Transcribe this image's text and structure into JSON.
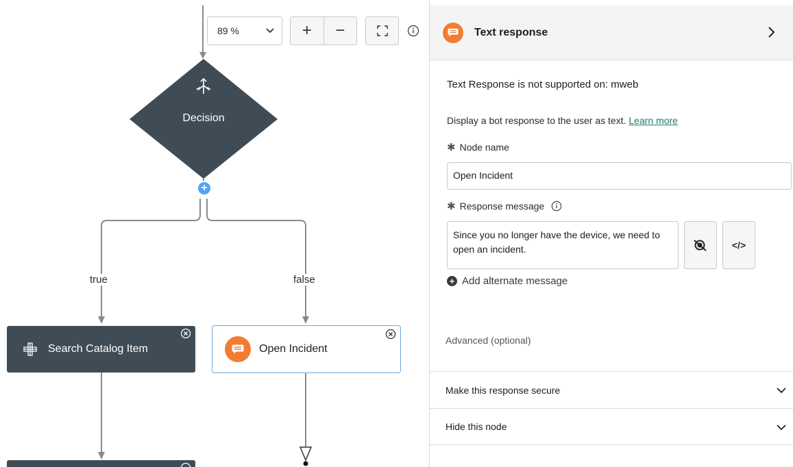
{
  "canvas": {
    "zoom": {
      "value": "89 %"
    },
    "zoom_in": "+",
    "zoom_out": "−",
    "decision": {
      "label": "Decision"
    },
    "branches": {
      "true_label": "true",
      "false_label": "false"
    },
    "nodes": {
      "search_catalog": {
        "label": "Search Catalog Item"
      },
      "open_incident": {
        "label": "Open Incident"
      }
    }
  },
  "panel": {
    "title": "Text response",
    "notice": "Text Response is not supported on: mweb",
    "description": "Display a bot response to the user as text.",
    "learn_more": "Learn more",
    "node_name": {
      "label": "Node name",
      "value": "Open Incident"
    },
    "response_message": {
      "label": "Response message",
      "value": "Since you no longer have the device, we need to open an incident."
    },
    "code_button": "</>",
    "add_alternate": "Add alternate message",
    "advanced": "Advanced (optional)",
    "sections": [
      {
        "label": "Make this response secure"
      },
      {
        "label": "Hide this node"
      }
    ]
  },
  "colors": {
    "node_dark": "#3f4c56",
    "accent_orange": "#f27c32",
    "add_blue": "#4fa6f2",
    "link_green": "#1f7a6d",
    "selected_border": "#6aa9e6"
  }
}
